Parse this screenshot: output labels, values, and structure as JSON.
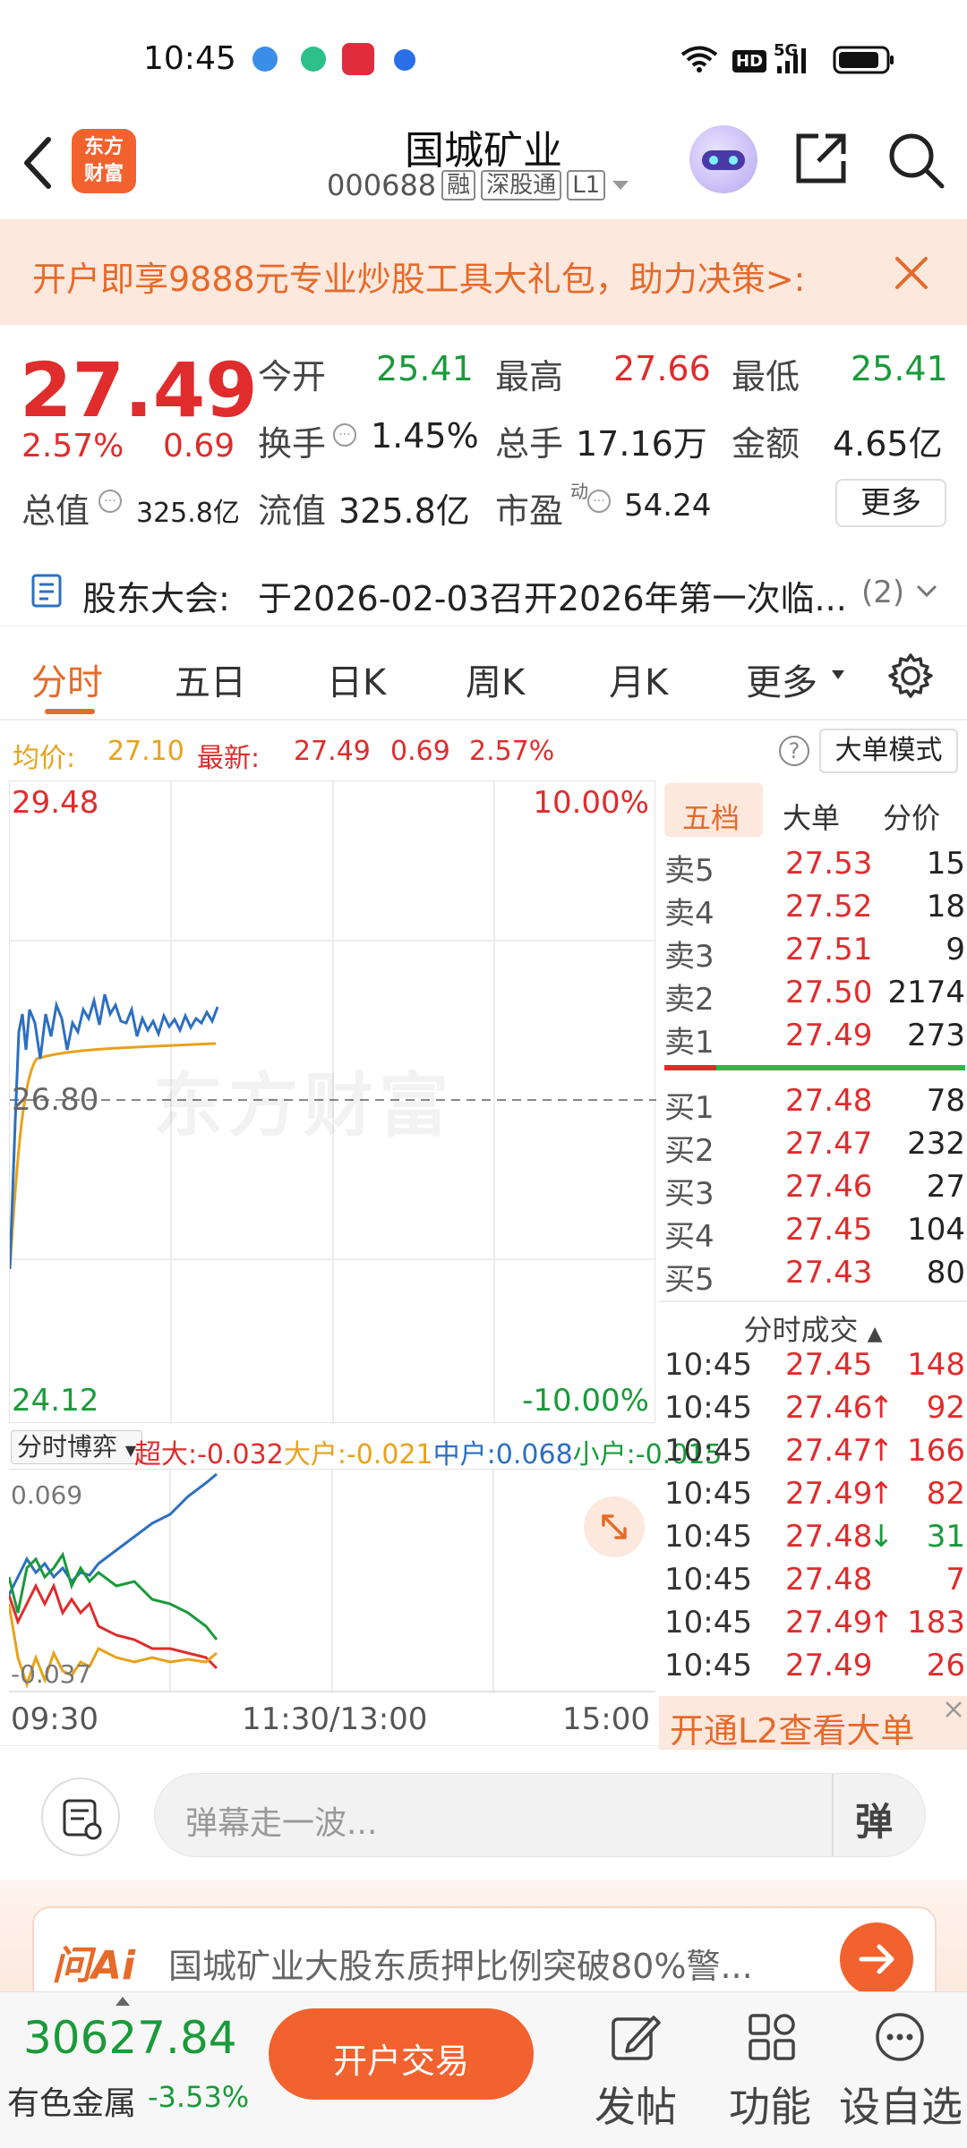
{
  "status_bar": {
    "time": "10:45",
    "hd": "HD",
    "net": "5G"
  },
  "nav": {
    "logo_line1": "东方",
    "logo_line2": "财富",
    "stock_name": "国城矿业",
    "stock_code": "000688",
    "tags": [
      "融",
      "深股通",
      "L1"
    ]
  },
  "banner": {
    "text": "开户即享9888元专业炒股工具大礼包，助力决策>:"
  },
  "quote": {
    "price": "27.49",
    "change_pct": "2.57%",
    "change": "0.69",
    "open_label": "今开",
    "open": "25.41",
    "high_label": "最高",
    "high": "27.66",
    "low_label": "最低",
    "low": "25.41",
    "turnover_label": "换手",
    "turnover": "1.45%",
    "volume_label": "总手",
    "volume": "17.16万",
    "amount_label": "金额",
    "amount": "4.65亿",
    "mcap_label": "总值",
    "mcap": "325.8亿",
    "float_label": "流值",
    "float": "325.8亿",
    "pe_label": "市盈",
    "pe_sup": "动",
    "pe": "54.24",
    "more": "更多"
  },
  "notice": {
    "label": "股东大会:",
    "text": "于2026-02-03召开2026年第一次临...",
    "count": "(2)"
  },
  "tabs": [
    "分时",
    "五日",
    "日K",
    "周K",
    "月K",
    "更多"
  ],
  "avg_line": {
    "avg_label": "均价:",
    "avg": "27.10",
    "latest_label": "最新:",
    "latest": "27.49",
    "chg": "0.69",
    "pct": "2.57%",
    "mode_button": "大单模式"
  },
  "chart": {
    "top_price": "29.48",
    "top_pct": "10.00%",
    "mid_price": "26.80",
    "bottom_price": "24.12",
    "bottom_pct": "-10.00%",
    "watermark": "东方财富",
    "flow_select": "分时博弈",
    "flow_items": [
      {
        "label": "超大:",
        "value": "-0.032",
        "color": "#e02c2c"
      },
      {
        "label": "大户:",
        "value": "-0.021",
        "color": "#e8a21a"
      },
      {
        "label": "中户:",
        "value": "0.068",
        "color": "#2d6fc0"
      },
      {
        "label": "小户:",
        "value": "-0.015",
        "color": "#1a9a3a"
      }
    ],
    "flow_top": "0.069",
    "flow_bottom": "-0.037",
    "time_start": "09:30",
    "time_mid": "11:30/13:00",
    "time_end": "15:00",
    "colors": {
      "price_line": "#2d6fc0",
      "avg_line": "#e8a21a"
    }
  },
  "order_book": {
    "tabs": [
      "五档",
      "大单",
      "分价"
    ],
    "asks": [
      {
        "label": "卖5",
        "price": "27.53",
        "vol": "15"
      },
      {
        "label": "卖4",
        "price": "27.52",
        "vol": "18"
      },
      {
        "label": "卖3",
        "price": "27.51",
        "vol": "9"
      },
      {
        "label": "卖2",
        "price": "27.50",
        "vol": "2174"
      },
      {
        "label": "卖1",
        "price": "27.49",
        "vol": "273"
      }
    ],
    "bids": [
      {
        "label": "买1",
        "price": "27.48",
        "vol": "78"
      },
      {
        "label": "买2",
        "price": "27.47",
        "vol": "232"
      },
      {
        "label": "买3",
        "price": "27.46",
        "vol": "27"
      },
      {
        "label": "买4",
        "price": "27.45",
        "vol": "104"
      },
      {
        "label": "买5",
        "price": "27.43",
        "vol": "80"
      }
    ],
    "trades_title": "分时成交",
    "trades": [
      {
        "time": "10:45",
        "price": "27.45",
        "arrow": "",
        "vol": "148",
        "dir": "red"
      },
      {
        "time": "10:45",
        "price": "27.46",
        "arrow": "↑",
        "vol": "92",
        "dir": "red"
      },
      {
        "time": "10:45",
        "price": "27.47",
        "arrow": "↑",
        "vol": "166",
        "dir": "red"
      },
      {
        "time": "10:45",
        "price": "27.49",
        "arrow": "↑",
        "vol": "82",
        "dir": "red"
      },
      {
        "time": "10:45",
        "price": "27.48",
        "arrow": "↓",
        "vol": "31",
        "dir": "green"
      },
      {
        "time": "10:45",
        "price": "27.48",
        "arrow": "",
        "vol": "7",
        "dir": "red"
      },
      {
        "time": "10:45",
        "price": "27.49",
        "arrow": "↑",
        "vol": "183",
        "dir": "red"
      },
      {
        "time": "10:45",
        "price": "27.49",
        "arrow": "",
        "vol": "26",
        "dir": "red"
      }
    ],
    "l2_text": "开通L2查看大单"
  },
  "danmu": {
    "placeholder": "弹幕走一波...",
    "button": "弹"
  },
  "ai": {
    "brand": "问Ai",
    "text": "国城矿业大股东质押比例突破80%警..."
  },
  "bottom": {
    "index_value": "30627.84",
    "index_name": "有色金属",
    "index_pct": "-3.53%",
    "trade_button": "开户交易",
    "post": "发帖",
    "functions": "功能",
    "watchlist": "设自选"
  }
}
